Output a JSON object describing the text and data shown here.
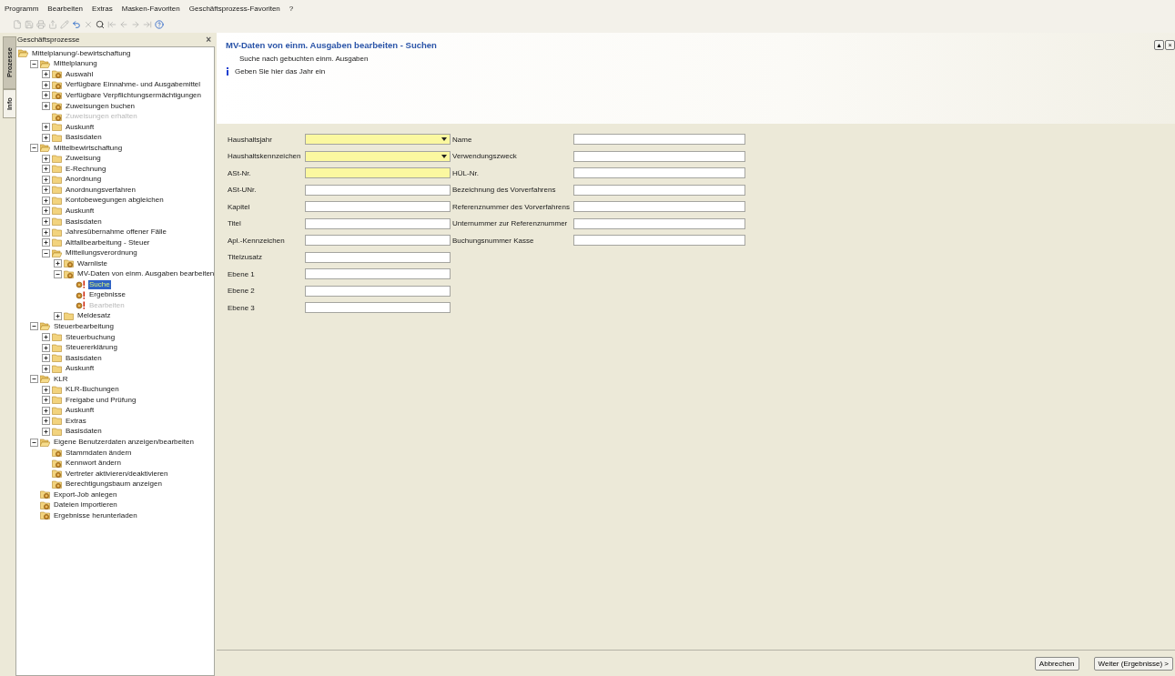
{
  "menu": [
    "Programm",
    "Bearbeiten",
    "Extras",
    "Masken-Favoriten",
    "Geschäftsprozess-Favoriten",
    "?"
  ],
  "toolbar": [
    {
      "kind": "new",
      "disabled": true
    },
    {
      "kind": "save",
      "disabled": true
    },
    {
      "kind": "print",
      "disabled": true
    },
    {
      "kind": "export",
      "disabled": true
    },
    {
      "kind": "edit",
      "disabled": true
    },
    {
      "kind": "undo",
      "disabled": false
    },
    {
      "kind": "delete",
      "disabled": true
    },
    {
      "kind": "search",
      "disabled": false
    },
    {
      "kind": "first",
      "disabled": true
    },
    {
      "kind": "prev",
      "disabled": true
    },
    {
      "kind": "next",
      "disabled": true
    },
    {
      "kind": "last",
      "disabled": true
    },
    {
      "kind": "help",
      "disabled": false
    }
  ],
  "side_tabs": [
    {
      "label": "Prozesse",
      "selected": true
    },
    {
      "label": "Info",
      "selected": false
    }
  ],
  "tree_panel": {
    "title": "Geschäftsprozesse",
    "close": "×",
    "items": [
      {
        "label": "Mittelplanung/-bewirtschaftung",
        "kind": "folder",
        "expanded": true,
        "selected": false,
        "disabled": false,
        "children": [
          {
            "label": "Mittelplanung",
            "kind": "folder",
            "expanded": true,
            "selected": false,
            "disabled": false,
            "children": [
              {
                "label": "Auswahl",
                "kind": "process",
                "expanded": false,
                "selected": false,
                "disabled": false
              },
              {
                "label": "Verfügbare Einnahme- und Ausgabemittel",
                "kind": "process",
                "expanded": false,
                "selected": false,
                "disabled": false
              },
              {
                "label": "Verfügbare Verpflichtungsermächtigungen",
                "kind": "process",
                "expanded": false,
                "selected": false,
                "disabled": false
              },
              {
                "label": "Zuweisungen buchen",
                "kind": "process",
                "expanded": false,
                "selected": false,
                "disabled": false
              },
              {
                "label": "Zuweisungen erhalten",
                "kind": "process",
                "selected": false,
                "disabled": true
              },
              {
                "label": "Auskunft",
                "kind": "folder",
                "expanded": false,
                "selected": false,
                "disabled": false
              },
              {
                "label": "Basisdaten",
                "kind": "folder",
                "expanded": false,
                "selected": false,
                "disabled": false
              }
            ]
          },
          {
            "label": "Mittelbewirtschaftung",
            "kind": "folder",
            "expanded": true,
            "selected": false,
            "disabled": false,
            "children": [
              {
                "label": "Zuweisung",
                "kind": "folder",
                "expanded": false,
                "selected": false,
                "disabled": false
              },
              {
                "label": "E-Rechnung",
                "kind": "folder",
                "expanded": false,
                "selected": false,
                "disabled": false
              },
              {
                "label": "Anordnung",
                "kind": "folder",
                "expanded": false,
                "selected": false,
                "disabled": false
              },
              {
                "label": "Anordnungsverfahren",
                "kind": "folder",
                "expanded": false,
                "selected": false,
                "disabled": false
              },
              {
                "label": "Kontobewegungen abgleichen",
                "kind": "folder",
                "expanded": false,
                "selected": false,
                "disabled": false
              },
              {
                "label": "Auskunft",
                "kind": "folder",
                "expanded": false,
                "selected": false,
                "disabled": false
              },
              {
                "label": "Basisdaten",
                "kind": "folder",
                "expanded": false,
                "selected": false,
                "disabled": false
              },
              {
                "label": "Jahresübernahme offener Fälle",
                "kind": "folder",
                "expanded": false,
                "selected": false,
                "disabled": false
              },
              {
                "label": "Altfallbearbeitung - Steuer",
                "kind": "folder",
                "expanded": false,
                "selected": false,
                "disabled": false
              },
              {
                "label": "Mitteilungsverordnung",
                "kind": "folder",
                "expanded": true,
                "selected": false,
                "disabled": false,
                "children": [
                  {
                    "label": "Warnliste",
                    "kind": "process",
                    "expanded": false,
                    "selected": false,
                    "disabled": false
                  },
                  {
                    "label": "MV-Daten von einm. Ausgaben bearbeiten",
                    "kind": "process",
                    "expanded": true,
                    "selected": false,
                    "disabled": false,
                    "children": [
                      {
                        "label": "Suche",
                        "kind": "step",
                        "selected": true,
                        "disabled": false
                      },
                      {
                        "label": "Ergebnisse",
                        "kind": "step",
                        "selected": false,
                        "disabled": false
                      },
                      {
                        "label": "Bearbeiten",
                        "kind": "step",
                        "selected": false,
                        "disabled": true
                      }
                    ]
                  },
                  {
                    "label": "Meldesatz",
                    "kind": "folder",
                    "expanded": false,
                    "selected": false,
                    "disabled": false
                  }
                ]
              }
            ]
          },
          {
            "label": "Steuerbearbeitung",
            "kind": "folder",
            "expanded": true,
            "selected": false,
            "disabled": false,
            "children": [
              {
                "label": "Steuerbuchung",
                "kind": "folder",
                "expanded": false,
                "selected": false,
                "disabled": false
              },
              {
                "label": "Steuererklärung",
                "kind": "folder",
                "expanded": false,
                "selected": false,
                "disabled": false
              },
              {
                "label": "Basisdaten",
                "kind": "folder",
                "expanded": false,
                "selected": false,
                "disabled": false
              },
              {
                "label": "Auskunft",
                "kind": "folder",
                "expanded": false,
                "selected": false,
                "disabled": false
              }
            ]
          },
          {
            "label": "KLR",
            "kind": "folder",
            "expanded": true,
            "selected": false,
            "disabled": false,
            "children": [
              {
                "label": "KLR-Buchungen",
                "kind": "folder",
                "expanded": false,
                "selected": false,
                "disabled": false
              },
              {
                "label": "Freigabe und Prüfung",
                "kind": "folder",
                "expanded": false,
                "selected": false,
                "disabled": false
              },
              {
                "label": "Auskunft",
                "kind": "folder",
                "expanded": false,
                "selected": false,
                "disabled": false
              },
              {
                "label": "Extras",
                "kind": "folder",
                "expanded": false,
                "selected": false,
                "disabled": false
              },
              {
                "label": "Basisdaten",
                "kind": "folder",
                "expanded": false,
                "selected": false,
                "disabled": false
              }
            ]
          },
          {
            "label": "Eigene Benutzerdaten anzeigen/bearbeiten",
            "kind": "folder",
            "expanded": true,
            "selected": false,
            "disabled": false,
            "children": [
              {
                "label": "Stammdaten ändern",
                "kind": "process",
                "selected": false,
                "disabled": false
              },
              {
                "label": "Kennwort ändern",
                "kind": "process",
                "selected": false,
                "disabled": false
              },
              {
                "label": "Vertreter aktivieren/deaktivieren",
                "kind": "process",
                "selected": false,
                "disabled": false
              },
              {
                "label": "Berechtigungsbaum anzeigen",
                "kind": "process",
                "selected": false,
                "disabled": false
              }
            ]
          },
          {
            "label": "Export-Job anlegen",
            "kind": "process",
            "selected": false,
            "disabled": false
          },
          {
            "label": "Dateien importieren",
            "kind": "process",
            "selected": false,
            "disabled": false
          },
          {
            "label": "Ergebnisse herunterladen",
            "kind": "process",
            "selected": false,
            "disabled": false
          }
        ]
      }
    ]
  },
  "page": {
    "title": "MV-Daten von einm. Ausgaben bearbeiten - Suchen",
    "subtitle": "Suche nach gebuchten einm. Ausgaben",
    "hint": "Geben Sie hier das Jahr ein",
    "header_buttons": [
      "▲",
      "×"
    ]
  },
  "form": {
    "left": [
      {
        "label": "Haushaltsjahr",
        "kind": "dropdown",
        "required": true
      },
      {
        "label": "Haushaltskennzeichen",
        "kind": "dropdown",
        "required": true
      },
      {
        "label": "ASt-Nr.",
        "kind": "text",
        "required": true
      },
      {
        "label": "ASt-UNr.",
        "kind": "text",
        "required": false
      },
      {
        "label": "Kapitel",
        "kind": "text",
        "required": false
      },
      {
        "label": "Titel",
        "kind": "text",
        "required": false
      },
      {
        "label": "Apl.-Kennzeichen",
        "kind": "text",
        "required": false
      },
      {
        "label": "Titelzusatz",
        "kind": "text",
        "required": false
      },
      {
        "label": "Ebene 1",
        "kind": "text",
        "required": false
      },
      {
        "label": "Ebene 2",
        "kind": "text",
        "required": false
      },
      {
        "label": "Ebene 3",
        "kind": "text",
        "required": false
      }
    ],
    "right": [
      {
        "label": "Name",
        "kind": "text",
        "required": false
      },
      {
        "label": "Verwendungszweck",
        "kind": "text",
        "required": false
      },
      {
        "label": "HÜL-Nr.",
        "kind": "text",
        "required": false
      },
      {
        "label": "Bezeichnung des Vorverfahrens",
        "kind": "text",
        "required": false
      },
      {
        "label": "Referenznummer des Vorverfahrens",
        "kind": "text",
        "required": false
      },
      {
        "label": "Unternummer zur Referenznummer",
        "kind": "text",
        "required": false
      },
      {
        "label": "Buchungsnummer Kasse",
        "kind": "text",
        "required": false
      }
    ]
  },
  "buttons": [
    "Abbrechen",
    "Weiter (Ergebnisse) >"
  ]
}
